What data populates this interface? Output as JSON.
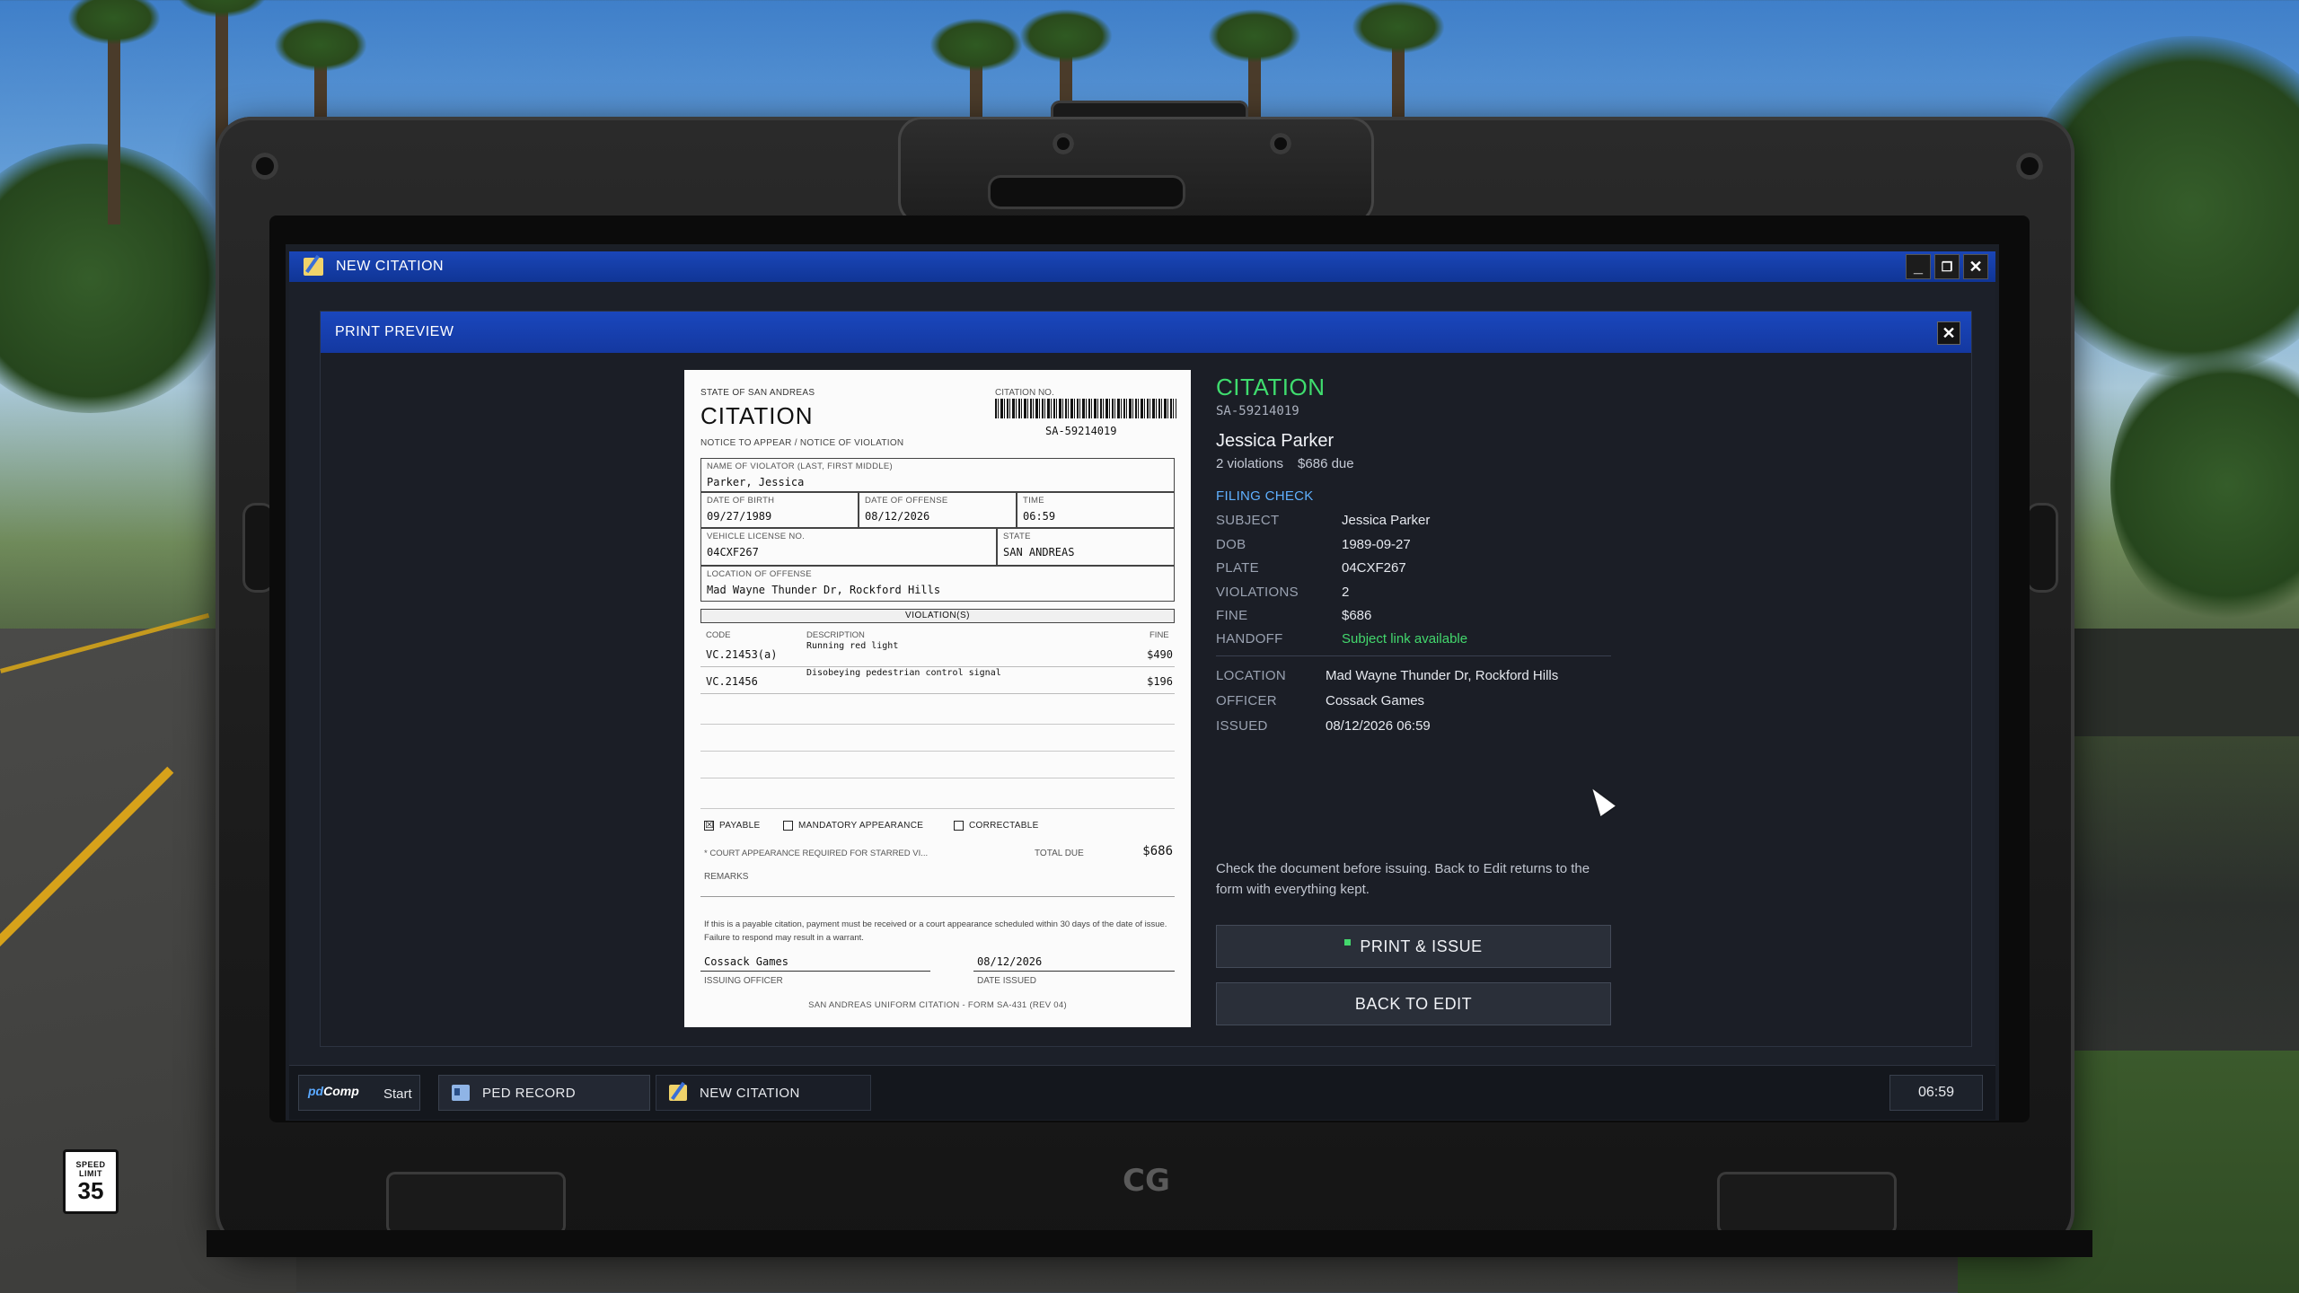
{
  "window": {
    "title": "NEW CITATION",
    "controls": {
      "minimize": "_",
      "restore": "❐",
      "close": "✕"
    }
  },
  "dialog": {
    "title": "PRINT PREVIEW",
    "close": "✕"
  },
  "citation_doc": {
    "state": "STATE OF SAN ANDREAS",
    "title": "CITATION",
    "notice": "NOTICE TO APPEAR / NOTICE OF VIOLATION",
    "citation_no_label": "CITATION NO.",
    "citation_no": "SA-59214019",
    "fields": {
      "violator_label": "NAME OF VIOLATOR (LAST, FIRST MIDDLE)",
      "violator": "Parker, Jessica",
      "dob_label": "DATE OF BIRTH",
      "dob": "09/27/1989",
      "offense_date_label": "DATE OF OFFENSE",
      "offense_date": "08/12/2026",
      "time_label": "TIME",
      "time": "06:59",
      "plate_label": "VEHICLE LICENSE NO.",
      "plate": "04CXF267",
      "state_label": "STATE",
      "state": "SAN ANDREAS",
      "location_label": "LOCATION OF OFFENSE",
      "location": "Mad Wayne Thunder Dr, Rockford Hills"
    },
    "violations_header": "VIOLATION(S)",
    "columns": {
      "code": "CODE",
      "description": "DESCRIPTION",
      "fine": "FINE"
    },
    "violations": [
      {
        "code": "VC.21453(a)",
        "description": "Running red light",
        "fine": "$490"
      },
      {
        "code": "VC.21456",
        "description": "Disobeying pedestrian control signal",
        "fine": "$196"
      }
    ],
    "checkboxes": {
      "payable": "PAYABLE",
      "payable_mark": "☒",
      "mandatory": "MANDATORY APPEARANCE",
      "correctable": "CORRECTABLE"
    },
    "court_note": "* COURT APPEARANCE REQUIRED FOR STARRED VI...",
    "total_label": "TOTAL DUE",
    "total": "$686",
    "remarks_label": "REMARKS",
    "legal": "If this is a payable citation, payment must be received or a court appearance scheduled within 30 days of the date of issue. Failure to respond may result in a warrant.",
    "officer": "Cossack Games",
    "officer_label": "ISSUING OFFICER",
    "date_issued": "08/12/2026",
    "date_issued_label": "DATE ISSUED",
    "form": "SAN ANDREAS UNIFORM CITATION - FORM SA-431 (REV 04)"
  },
  "summary": {
    "title": "CITATION",
    "citation_no": "SA-59214019",
    "name": "Jessica Parker",
    "violations_count": "2 violations",
    "amount_due": "$686 due",
    "section": "FILING CHECK",
    "check": [
      {
        "key": "SUBJECT",
        "value": "Jessica Parker"
      },
      {
        "key": "DOB",
        "value": "1989-09-27"
      },
      {
        "key": "PLATE",
        "value": "04CXF267"
      },
      {
        "key": "VIOLATIONS",
        "value": "2"
      },
      {
        "key": "FINE",
        "value": "$686"
      },
      {
        "key": "HANDOFF",
        "value": "Subject link available",
        "status_color": "#43d86d"
      }
    ],
    "details": [
      {
        "key": "LOCATION",
        "value": "Mad Wayne Thunder Dr, Rockford Hills"
      },
      {
        "key": "OFFICER",
        "value": "Cossack Games"
      },
      {
        "key": "ISSUED",
        "value": "08/12/2026 06:59"
      }
    ],
    "note": "Check the document before issuing. Back to Edit returns to the form with everything kept.",
    "print_button": "PRINT & ISSUE",
    "back_button": "BACK TO EDIT"
  },
  "taskbar": {
    "logo_a": "pd",
    "logo_b": "Comp",
    "start": "Start",
    "tasks": [
      {
        "label": "PED RECORD",
        "icon": "id-card-icon"
      },
      {
        "label": "NEW CITATION",
        "icon": "edit-document-icon"
      }
    ],
    "clock": "06:59"
  },
  "world": {
    "speed_sign_top": "SPEED LIMIT",
    "speed_sign_value": "35",
    "laptop_logo": "CG"
  },
  "colors": {
    "accent_blue": "#1a46b8",
    "citation_green": "#3fdc6e",
    "section_blue": "#5fb0ff",
    "ok_green": "#43d86d"
  }
}
